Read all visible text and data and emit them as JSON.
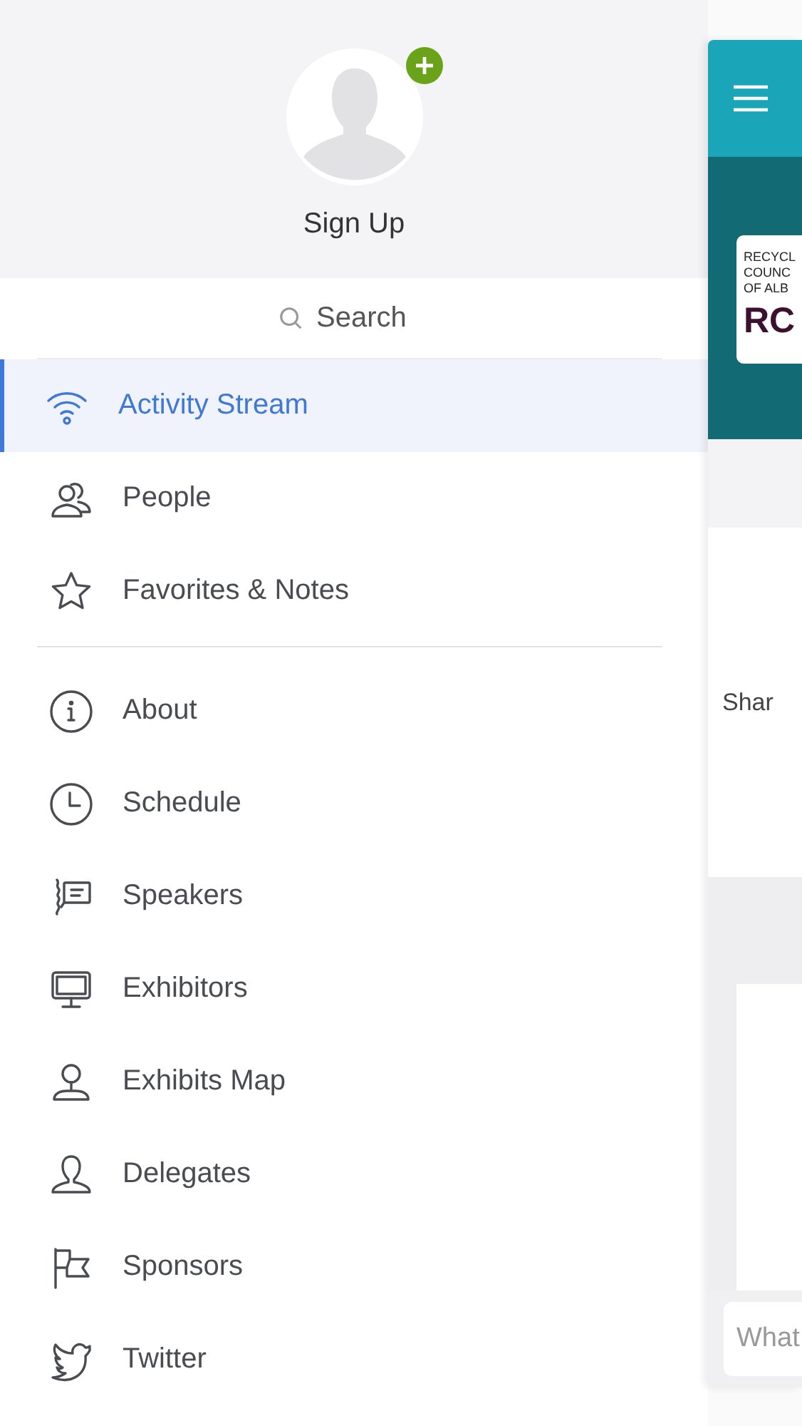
{
  "profile": {
    "name": "Sign Up"
  },
  "search": {
    "placeholder": "Search"
  },
  "menu_groups": [
    [
      {
        "label": "Activity Stream",
        "kind": "wifi",
        "selected": true
      },
      {
        "label": "People",
        "kind": "people",
        "selected": false
      },
      {
        "label": "Favorites & Notes",
        "kind": "star",
        "selected": false
      }
    ],
    [
      {
        "label": "About",
        "kind": "info",
        "selected": false
      },
      {
        "label": "Schedule",
        "kind": "clock",
        "selected": false
      },
      {
        "label": "Speakers",
        "kind": "speaker",
        "selected": false
      },
      {
        "label": "Exhibitors",
        "kind": "monitor",
        "selected": false
      },
      {
        "label": "Exhibits Map",
        "kind": "pin",
        "selected": false
      },
      {
        "label": "Delegates",
        "kind": "person",
        "selected": false
      },
      {
        "label": "Sponsors",
        "kind": "flag",
        "selected": false
      },
      {
        "label": "Twitter",
        "kind": "bird",
        "selected": false
      }
    ]
  ],
  "background_app": {
    "logo_lines": [
      "RECYCL",
      "COUNC",
      "OF ALB"
    ],
    "logo_mark": "RC",
    "share_text": "Shar",
    "composer": {
      "placeholder": "What"
    }
  }
}
